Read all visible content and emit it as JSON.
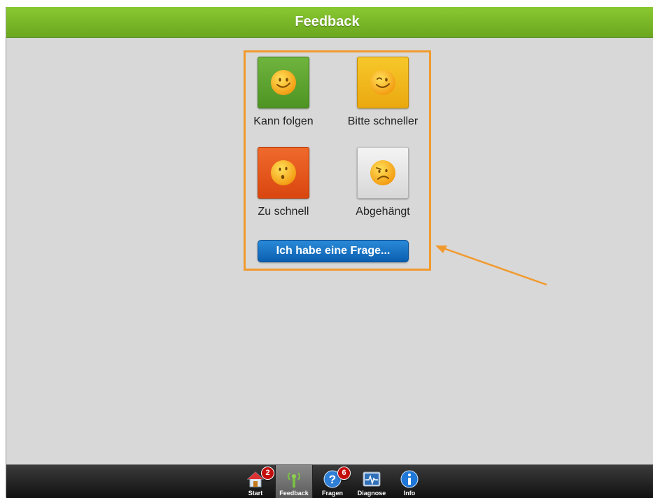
{
  "header": {
    "title": "Feedback"
  },
  "feedback": {
    "options": [
      {
        "label": "Kann folgen",
        "icon": "smile-face-icon",
        "color": "#5ca62f"
      },
      {
        "label": "Bitte schneller",
        "icon": "smile-face-icon",
        "color": "#f0b81c"
      },
      {
        "label": "Zu schnell",
        "icon": "worried-face-icon",
        "color": "#e0541a"
      },
      {
        "label": "Abgehängt",
        "icon": "sad-face-icon",
        "color": "#e4e4e4"
      }
    ],
    "question_button": "Ich habe eine Frage..."
  },
  "annotation": {
    "highlight_color": "#f29a2e"
  },
  "tabbar": {
    "tabs": [
      {
        "label": "Start",
        "icon": "home-icon",
        "badge": "2"
      },
      {
        "label": "Feedback",
        "icon": "antenna-icon",
        "active": true
      },
      {
        "label": "Fragen",
        "icon": "question-icon",
        "badge": "6"
      },
      {
        "label": "Diagnose",
        "icon": "pulse-monitor-icon"
      },
      {
        "label": "Info",
        "icon": "info-icon"
      }
    ]
  },
  "colors": {
    "header": "#7ab828",
    "background": "#d8d8d8",
    "button": "#1a75c4"
  }
}
